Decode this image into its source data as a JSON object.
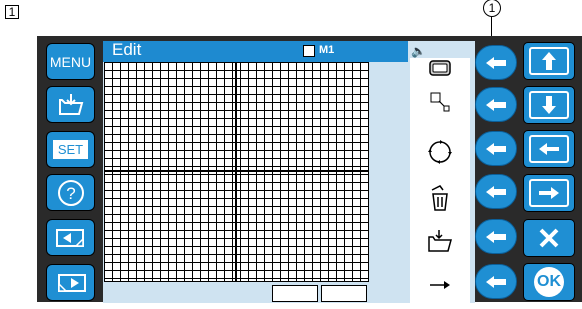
{
  "figure": {
    "step_number": "1",
    "callout_number": "1"
  },
  "screen": {
    "title": "Edit",
    "memory_label": "M1"
  },
  "left_menu": {
    "menu_label": "MENU",
    "set_label": "SET",
    "help_label": "?"
  },
  "right_keys": {
    "ok_label": "OK"
  },
  "icons": {
    "left": [
      "open-folder-icon",
      "help-icon",
      "page-back-icon",
      "page-forward-icon"
    ],
    "tools": [
      "frame-icon",
      "resize-icon",
      "rotate-icon",
      "delete-icon",
      "save-icon",
      "next-arrow-icon"
    ],
    "arrows": [
      "up-arrow-icon",
      "down-arrow-icon",
      "left-arrow-icon",
      "right-arrow-icon",
      "cancel-icon",
      "ok-icon"
    ]
  },
  "colors": {
    "accent": "#1f8fd3",
    "screen_bg": "#cfe3f1",
    "titlebar": "#1e8ad0"
  }
}
